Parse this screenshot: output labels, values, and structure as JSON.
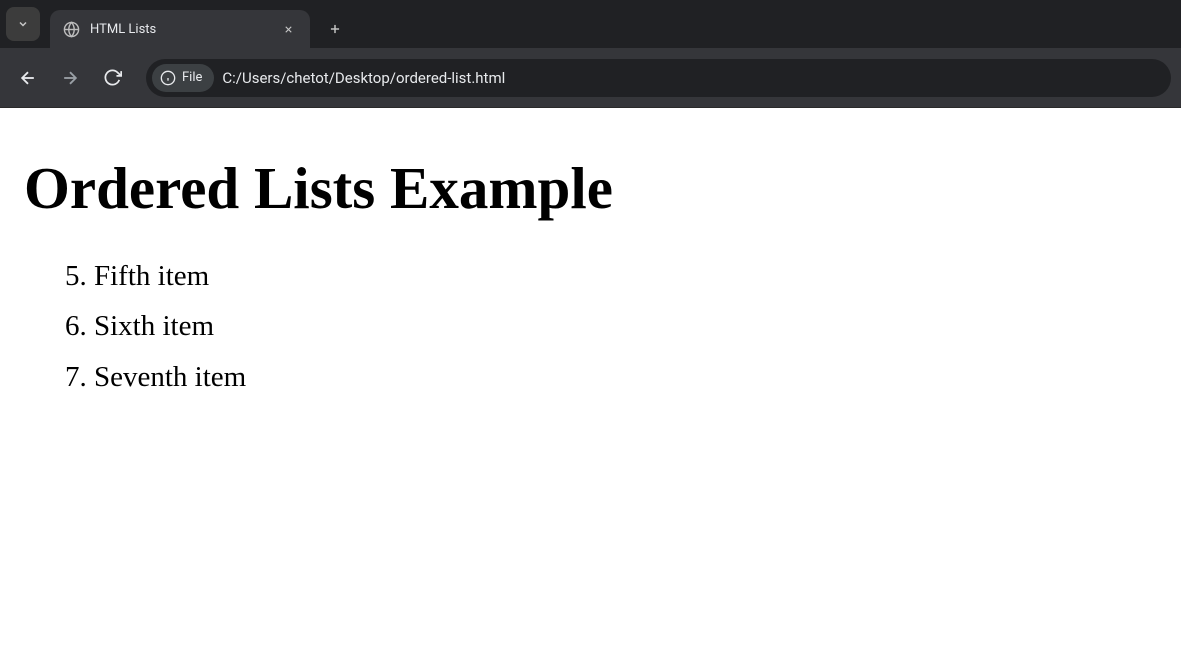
{
  "browser": {
    "tab": {
      "title": "HTML Lists"
    },
    "addressBar": {
      "fileChipLabel": "File",
      "url": "C:/Users/chetot/Desktop/ordered-list.html"
    }
  },
  "page": {
    "heading": "Ordered Lists Example",
    "list": {
      "start": 5,
      "items": [
        "Fifth item",
        "Sixth item",
        "Seventh item"
      ]
    }
  }
}
